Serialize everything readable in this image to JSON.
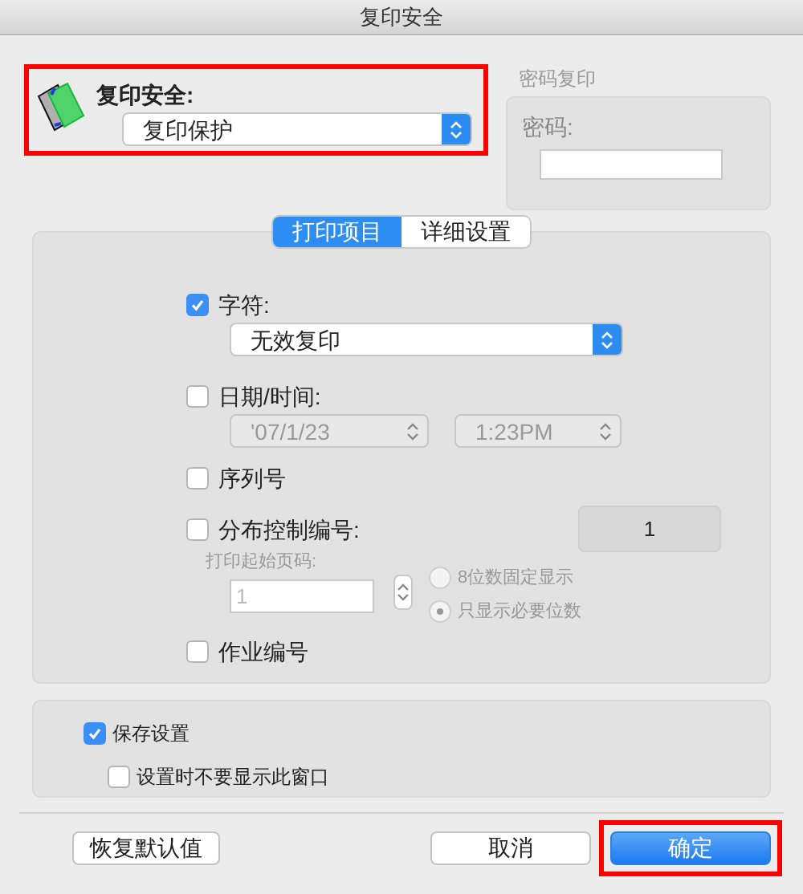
{
  "window": {
    "title": "复印安全"
  },
  "copy_security": {
    "label": "复印安全:",
    "value": "复印保护",
    "highlighted": true
  },
  "password_copy": {
    "title": "密码复印",
    "label": "密码:",
    "disabled": true
  },
  "tabs": [
    {
      "label": "打印项目",
      "selected": true
    },
    {
      "label": "详细设置",
      "selected": false
    }
  ],
  "items": [
    {
      "kind": "select",
      "label": "字符:",
      "checked": true,
      "value": "无效复印"
    },
    {
      "kind": "datetime",
      "label": "日期/时间:",
      "checked": false,
      "date": "'07/1/23",
      "time": "1:23PM"
    },
    {
      "kind": "plain",
      "label": "序列号",
      "checked": false
    },
    {
      "kind": "distribution",
      "label": "分布控制编号:",
      "checked": false,
      "number": "1",
      "start_label": "打印起始页码:",
      "start_value": "1",
      "options": [
        {
          "label": "8位数固定显示",
          "selected": false
        },
        {
          "label": "只显示必要位数",
          "selected": true
        }
      ]
    },
    {
      "kind": "plain",
      "label": "作业编号",
      "checked": false
    }
  ],
  "save_settings": {
    "label": "保存设置",
    "checked": true
  },
  "hide_window": {
    "label": "设置时不要显示此窗口",
    "checked": false
  },
  "buttons": [
    {
      "label": "恢复默认值",
      "kind": "default",
      "highlighted": false
    },
    {
      "label": "取消",
      "kind": "default",
      "highlighted": false
    },
    {
      "label": "确定",
      "kind": "primary",
      "highlighted": true
    }
  ]
}
